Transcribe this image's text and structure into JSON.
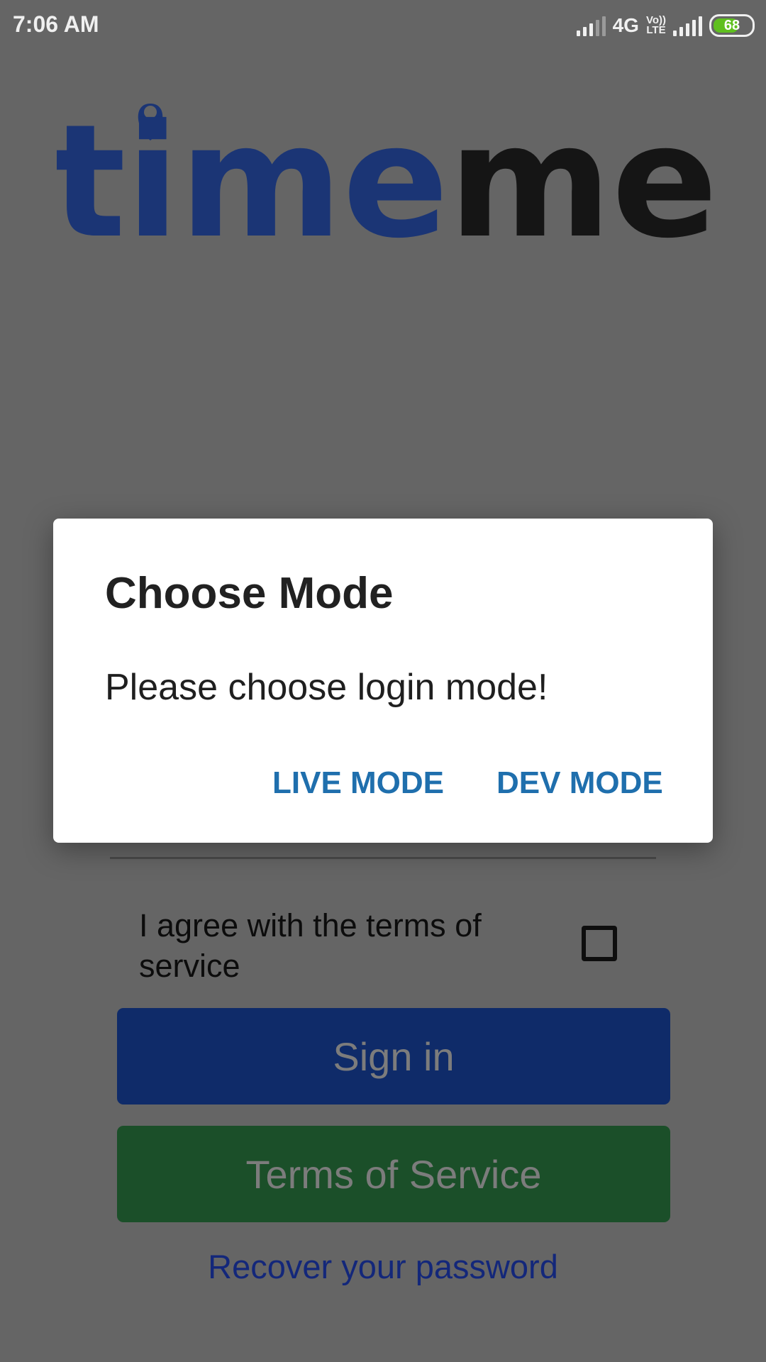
{
  "status_bar": {
    "time": "7:06 AM",
    "network_type": "4G",
    "volte_top": "Vo))",
    "volte_bottom": "LTE",
    "battery_level": "68",
    "battery_fraction": 0.68,
    "battery_fill_color": "#5fbf1f"
  },
  "logo": {
    "part1": "time",
    "part2": "me",
    "part1_color": "#1b3575",
    "part2_color": "#151515",
    "pin_color": "#1b3575"
  },
  "form": {
    "terms_label": "I agree with the terms of service",
    "terms_checked": false,
    "signin_label": "Sign in",
    "tos_label": "Terms of Service",
    "recover_label": "Recover your password"
  },
  "dialog": {
    "title": "Choose Mode",
    "message": "Please choose login mode!",
    "live_label": "LIVE MODE",
    "dev_label": "DEV MODE",
    "accent_color": "#1f6fad"
  }
}
